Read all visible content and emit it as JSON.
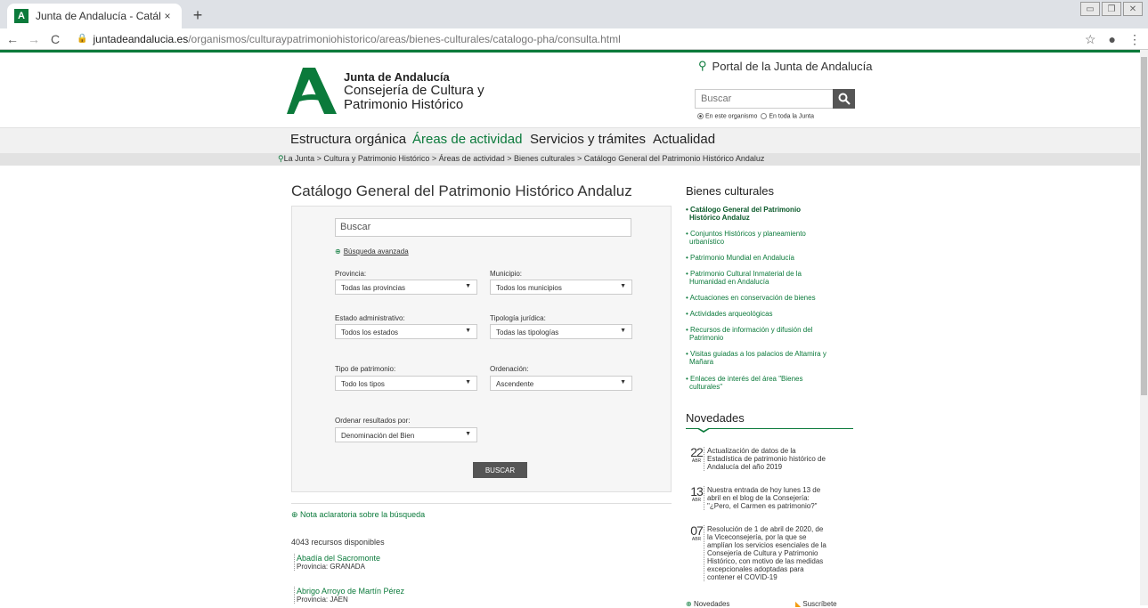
{
  "browser": {
    "tab_title": "Junta de Andalucía - Catálogo G...",
    "tab_close": "×",
    "new_tab": "+",
    "url_domain": "juntadeandalucia.es",
    "url_path": "/organismos/culturaypatrimoniohistorico/areas/bienes-culturales/catalogo-pha/consulta.html"
  },
  "header": {
    "org_name": "Junta de Andalucía",
    "dept_line1": "Consejería de Cultura y",
    "dept_line2": "Patrimonio Histórico",
    "portal_link": "Portal de la Junta de Andalucía",
    "search_placeholder": "Buscar",
    "scope_option1": "En este organismo",
    "scope_option2": "En toda la Junta"
  },
  "nav": {
    "items": [
      {
        "label": "Estructura orgánica"
      },
      {
        "label": "Áreas de actividad"
      },
      {
        "label": "Servicios y trámites"
      },
      {
        "label": "Actualidad"
      }
    ]
  },
  "breadcrumb": "La Junta > Cultura y Patrimonio Histórico > Áreas de actividad > Bienes culturales > Catálogo General del Patrimonio Histórico Andaluz",
  "main": {
    "title": "Catálogo General del Patrimonio Histórico Andaluz",
    "search_placeholder": "Buscar",
    "advanced_link": "Búsqueda avanzada",
    "fields": {
      "provincia_label": "Provincia:",
      "provincia_value": "Todas las provincias",
      "municipio_label": "Municipio:",
      "municipio_value": "Todos los municipios",
      "estado_label": "Estado administrativo:",
      "estado_value": "Todos los estados",
      "tipologia_label": "Tipología jurídica:",
      "tipologia_value": "Todas las tipologías",
      "tipo_label": "Tipo de patrimonio:",
      "tipo_value": "Todo los tipos",
      "ordenacion_label": "Ordenación:",
      "ordenacion_value": "Ascendente",
      "ordenar_label": "Ordenar resultados por:",
      "ordenar_value": "Denominación del Bien"
    },
    "search_button": "BUSCAR",
    "nota_link": "Nota aclaratoria sobre la búsqueda",
    "count_text": "4043 recursos disponibles",
    "results": [
      {
        "name": "Abadía del Sacromonte",
        "province": "Provincia: GRANADA"
      },
      {
        "name": "Abrigo Arroyo de Martín Pérez",
        "province": "Provincia: JAEN"
      }
    ]
  },
  "sidebar": {
    "title": "Bienes culturales",
    "links": [
      {
        "line1": "• Catálogo General del Patrimonio",
        "line2": "Histórico Andaluz"
      },
      {
        "line1": "• Conjuntos Históricos y planeamiento",
        "line2": "urbanístico"
      },
      {
        "line1": "• Patrimonio Mundial en Andalucía",
        "line2": ""
      },
      {
        "line1": "• Patrimonio Cultural Inmaterial de la",
        "line2": "Humanidad en Andalucía"
      },
      {
        "line1": "• Actuaciones en conservación de bienes",
        "line2": ""
      },
      {
        "line1": "• Actividades arqueológicas",
        "line2": ""
      },
      {
        "line1": "• Recursos de información y difusión del",
        "line2": "Patrimonio"
      },
      {
        "line1": "• Visitas guiadas a los palacios de Altamira y",
        "line2": "Mañara"
      },
      {
        "line1": "• Enlaces de interés del área \"Bienes",
        "line2": "culturales\""
      }
    ],
    "news_title": "Novedades",
    "news": [
      {
        "day": "22",
        "month": "ABR",
        "lines": [
          "Actualización de datos de la",
          "Estadística de patrimonio histórico de",
          "Andalucía del año 2019"
        ]
      },
      {
        "day": "13",
        "month": "ABR",
        "lines": [
          "Nuestra entrada de hoy lunes 13 de",
          "abril en el blog de la Consejería:",
          "\"¿Pero, el Carmen es patrimonio?\""
        ]
      },
      {
        "day": "07",
        "month": "ABR",
        "lines": [
          "Resolución de 1 de abril de 2020, de",
          "la Viceconsejería, por la que se",
          "amplían los servicios esenciales de la",
          "Consejería de Cultura y Patrimonio",
          "Histórico, con motivo de las medidas",
          "excepcionales adoptadas para",
          "contener el COVID-19"
        ]
      }
    ],
    "news_more": "Novedades",
    "subscribe": "Suscríbete"
  },
  "colors": {
    "brand_green": "#0b7a3b",
    "button_gray": "#555555"
  }
}
